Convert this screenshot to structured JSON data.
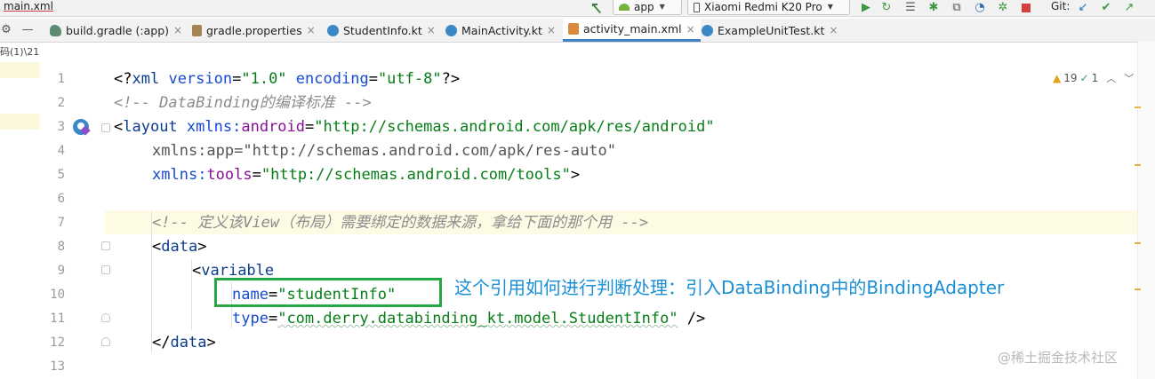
{
  "toolbar": {
    "file_title": "main.xml",
    "run_config": "app",
    "device": "Xiaomi Redmi K20 Pro",
    "git_label": "Git:"
  },
  "tabs": [
    {
      "label": "build.gradle (:app)",
      "icon": "gradle-icon",
      "active": false
    },
    {
      "label": "gradle.properties",
      "icon": "properties-icon",
      "active": false
    },
    {
      "label": "StudentInfo.kt",
      "icon": "kotlin-class-icon",
      "active": false
    },
    {
      "label": "MainActivity.kt",
      "icon": "kotlin-class-icon",
      "active": false
    },
    {
      "label": "activity_main.xml",
      "icon": "xml-layout-icon",
      "active": true
    },
    {
      "label": "ExampleUnitTest.kt",
      "icon": "kotlin-class-icon",
      "active": false
    }
  ],
  "breadcrumb": "码(1)\\21",
  "inspections": {
    "warnings": "19",
    "weak_warnings": "1"
  },
  "code": {
    "line_numbers": [
      "1",
      "2",
      "3",
      "4",
      "5",
      "6",
      "7",
      "8",
      "9",
      "10",
      "11",
      "12",
      "13"
    ],
    "l1": {
      "open": "<?",
      "tag": "xml",
      "sp1": " ",
      "a1": "version",
      "eq1": "=",
      "v1": "\"1.0\"",
      "sp2": " ",
      "a2": "encoding",
      "eq2": "=",
      "v2": "\"utf-8\"",
      "close": "?>"
    },
    "l2": "<!-- DataBinding的编译标准 -->",
    "l3": {
      "open": "<",
      "tag": "layout",
      "sp": " ",
      "attr": "xmlns",
      "colon": ":",
      "ns": "android",
      "eq": "=",
      "val": "\"http://schemas.android.com/apk/res/android\""
    },
    "l4": {
      "attr": "xmlns:app",
      "eq": "=",
      "val": "\"http://schemas.android.com/apk/res-auto\""
    },
    "l5": {
      "attr": "xmlns",
      "colon": ":",
      "ns": "tools",
      "eq": "=",
      "val": "\"http://schemas.android.com/tools\"",
      "close": ">"
    },
    "l7": "<!-- 定义该View（布局）需要绑定的数据来源，拿给下面的那个用 -->",
    "l8": {
      "open": "<",
      "tag": "data",
      "close": ">"
    },
    "l9": {
      "open": "<",
      "tag": "variable"
    },
    "l10": {
      "attr": "name",
      "eq": "=",
      "val": "\"studentInfo\""
    },
    "l11": {
      "attr": "type",
      "eq": "=",
      "val": "\"com.derry.databinding_kt.model.StudentInfo\"",
      "close": " />"
    },
    "l12": {
      "open": "</",
      "tag": "data",
      "close": ">"
    }
  },
  "annotation": "这个引用如何进行判断处理：引入DataBinding中的BindingAdapter",
  "watermark": "@稀土掘金技术社区",
  "colors": {
    "tag": "#0b3d8f",
    "attribute": "#174ad4",
    "namespace": "#871094",
    "string": "#067d17",
    "comment": "#8c8c8c",
    "annotation_box": "#27a845",
    "annotation_text": "#1a8fd6",
    "active_tab": "#4083c9"
  }
}
